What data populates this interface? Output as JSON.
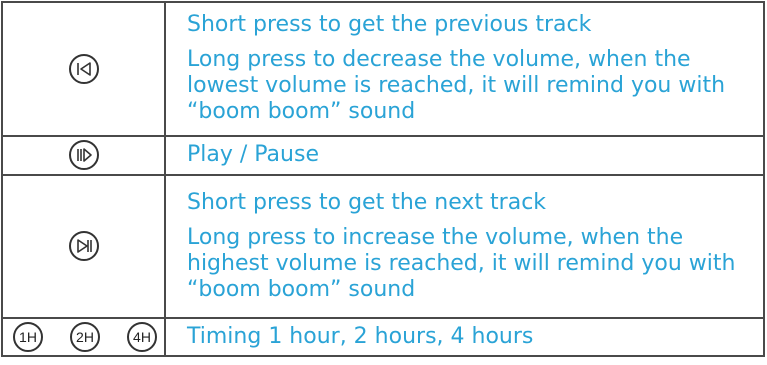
{
  "colors": {
    "text": "#2aa3d6",
    "border": "#4a4a4a",
    "icon": "#333333"
  },
  "rows": [
    {
      "icon": "previous-track-icon",
      "lines": [
        "Short press to get the previous track",
        "Long press to decrease the volume, when the lowest volume is reached, it will remind you with “boom boom” sound"
      ]
    },
    {
      "icon": "play-pause-icon",
      "lines": [
        "Play / Pause"
      ]
    },
    {
      "icon": "next-track-icon",
      "lines": [
        "Short press to get the next track",
        "Long press to increase the volume, when the highest volume is reached, it will remind you with “boom boom” sound"
      ]
    },
    {
      "icon": "timer-icons",
      "timers": [
        "1H",
        "2H",
        "4H"
      ],
      "lines": [
        "Timing 1 hour, 2 hours, 4 hours"
      ]
    }
  ]
}
